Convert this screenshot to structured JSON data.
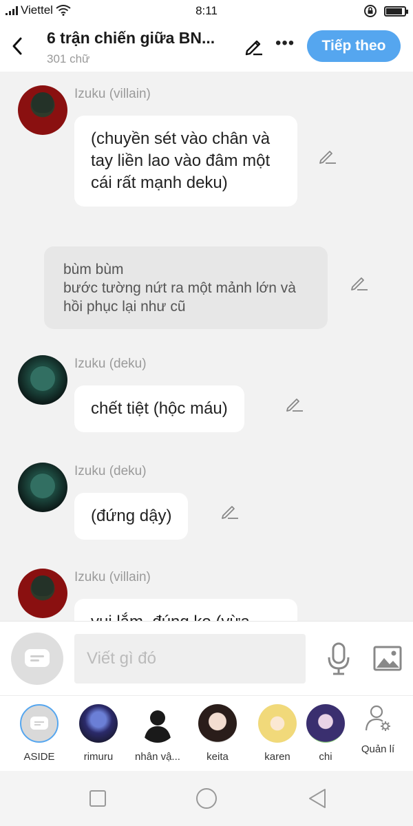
{
  "status_bar": {
    "carrier": "Viettel",
    "time": "8:11",
    "battery_level": 0.9
  },
  "header": {
    "title": "6 trận chiến giữa BN...",
    "word_count": "301 chữ",
    "next_label": "Tiếp theo"
  },
  "messages": [
    {
      "type": "character",
      "name": "Izuku (villain)",
      "text": "(chuyền sét vào chân và tay liền lao vào đâm một cái rất mạnh deku)"
    },
    {
      "type": "aside",
      "text_line1": "bùm bùm",
      "text_line2": "bước tường nứt ra một mảnh lớn và hồi phục lại như cũ"
    },
    {
      "type": "character",
      "name": "Izuku (deku)",
      "text": "chết tiệt (hộc máu)"
    },
    {
      "type": "character",
      "name": "Izuku (deku)",
      "text": "(đứng dậy)"
    },
    {
      "type": "character",
      "name": "Izuku (villain)",
      "text": "vui lắm, đúng ko (vừa"
    }
  ],
  "input": {
    "placeholder": "Viết gì đó"
  },
  "characters": [
    {
      "label": "ASIDE"
    },
    {
      "label": "rimuru"
    },
    {
      "label": "nhân vậ..."
    },
    {
      "label": "keita"
    },
    {
      "label": "karen"
    },
    {
      "label": "chi"
    }
  ],
  "manage_label": "Quản lí",
  "colors": {
    "accent": "#55a6ef",
    "background": "#f2f2f2",
    "bubble": "#ffffff",
    "aside_bubble": "#e7e7e7"
  }
}
